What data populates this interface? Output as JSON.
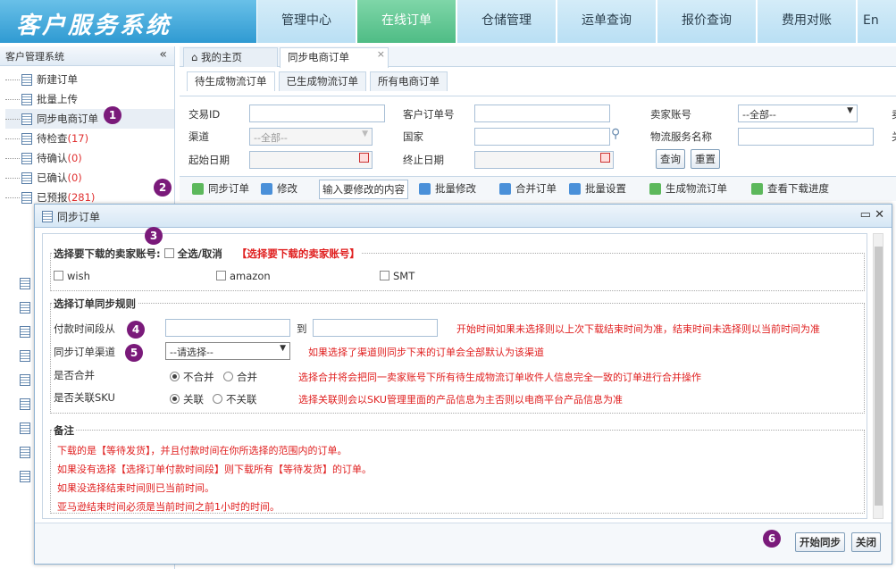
{
  "app": {
    "title": "客户服务系统"
  },
  "nav": [
    {
      "label": "管理中心"
    },
    {
      "label": "在线订单"
    },
    {
      "label": "仓储管理"
    },
    {
      "label": "运单查询"
    },
    {
      "label": "报价查询"
    },
    {
      "label": "费用对账"
    },
    {
      "label": "En"
    }
  ],
  "sidebar": {
    "title": "客户管理系统",
    "items": [
      {
        "label": "新建订单",
        "count": ""
      },
      {
        "label": "批量上传",
        "count": ""
      },
      {
        "label": "同步电商订单",
        "count": ""
      },
      {
        "label": "待检查",
        "count": "(17)"
      },
      {
        "label": "待确认",
        "count": "(0)"
      },
      {
        "label": "已确认",
        "count": "(0)"
      },
      {
        "label": "已预报",
        "count": "(281)"
      }
    ]
  },
  "tabs": [
    {
      "label": "我的主页"
    },
    {
      "label": "同步电商订单"
    }
  ],
  "subtabs": [
    {
      "label": "待生成物流订单"
    },
    {
      "label": "已生成物流订单"
    },
    {
      "label": "所有电商订单"
    }
  ],
  "filter": {
    "trade_id": "交易ID",
    "customer_order": "客户订单号",
    "seller_account": "卖家账号",
    "seller_value": "--全部--",
    "channel": "渠道",
    "channel_value": "--全部--",
    "country": "国家",
    "service": "物流服务名称",
    "start_date": "起始日期",
    "end_date": "终止日期",
    "query": "查询",
    "reset": "重置",
    "cut1": "卖",
    "cut2": "关"
  },
  "toolbar": {
    "sync": "同步订单",
    "edit": "修改",
    "edit_input": "输入要修改的内容",
    "batch_edit": "批量修改",
    "merge": "合并订单",
    "batch_set": "批量设置",
    "gen": "生成物流订单",
    "progress": "查看下载进度"
  },
  "badges": [
    "1",
    "2",
    "3",
    "4",
    "5",
    "6"
  ],
  "dialog": {
    "title": "同步订单",
    "accounts": {
      "title": "选择要下载的卖家账号:",
      "select_all": "全选/取消",
      "hint": "【选择要下载的卖家账号】",
      "items": [
        "wish",
        "amazon",
        "SMT"
      ]
    },
    "rules": {
      "title": "选择订单同步规则",
      "pay_time": "付款时间段从",
      "to": "到",
      "pay_hint": "开始时间如果未选择则以上次下载结束时间为准，结束时间未选择则以当前时间为准",
      "channel": "同步订单渠道",
      "channel_value": "--请选择--",
      "channel_hint": "如果选择了渠道则同步下来的订单会全部默认为该渠道",
      "merge": "是否合并",
      "no_merge": "不合并",
      "do_merge": "合并",
      "merge_hint": "选择合并将会把同一卖家账号下所有待生成物流订单收件人信息完全一致的订单进行合并操作",
      "sku": "是否关联SKU",
      "link": "关联",
      "no_link": "不关联",
      "sku_hint": "选择关联则会以SKU管理里面的产品信息为主否则以电商平台产品信息为准"
    },
    "notes": {
      "title": "备注",
      "lines": [
        "下载的是【等待发货】，并且付款时间在你所选择的范围内的订单。",
        "如果没有选择【选择订单付款时间段】则下载所有【等待发货】的订单。",
        "如果没选择结束时间则已当前时间。",
        "亚马逊结束时间必须是当前时间之前1小时的时间。"
      ]
    },
    "start": "开始同步",
    "close": "关闭"
  }
}
